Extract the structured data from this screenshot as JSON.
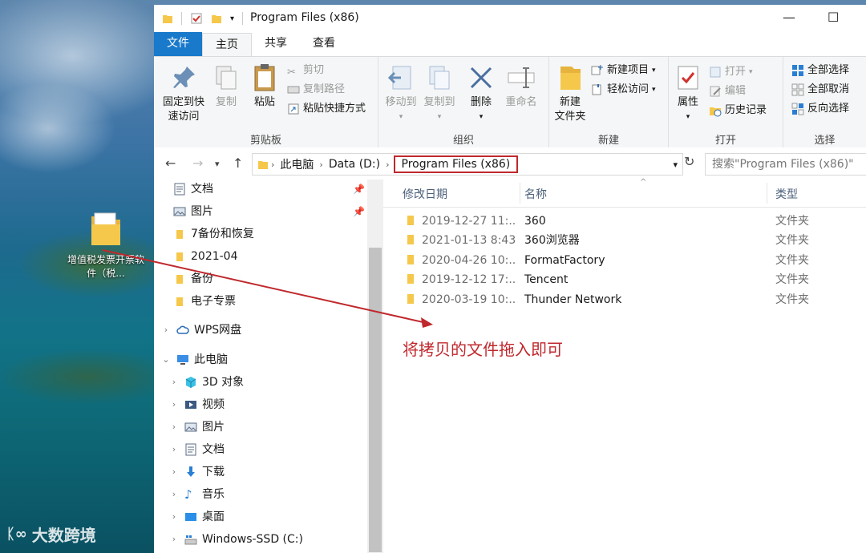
{
  "desktop": {
    "icon_label": "增值税发票开票软件（税...",
    "watermark": "大数跨境"
  },
  "window": {
    "title": "Program Files (x86)"
  },
  "ribbon_tabs": [
    "文件",
    "主页",
    "共享",
    "查看"
  ],
  "ribbon": {
    "clipboard": {
      "pin": "固定到快\n速访问",
      "copy": "复制",
      "paste": "粘贴",
      "cut": "剪切",
      "copy_path": "复制路径",
      "paste_shortcut": "粘贴快捷方式",
      "group": "剪贴板"
    },
    "organize": {
      "move_to": "移动到",
      "copy_to": "复制到",
      "delete": "删除",
      "rename": "重命名",
      "group": "组织"
    },
    "new": {
      "new_folder": "新建\n文件夹",
      "new_item": "新建项目",
      "easy_access": "轻松访问",
      "group": "新建"
    },
    "open": {
      "properties": "属性",
      "open": "打开",
      "edit": "编辑",
      "history": "历史记录",
      "group": "打开"
    },
    "select": {
      "select_all": "全部选择",
      "select_none": "全部取消",
      "invert": "反向选择",
      "group": "选择"
    }
  },
  "address": {
    "crumbs": [
      "此电脑",
      "Data (D:)",
      "Program Files (x86)"
    ],
    "search_placeholder": "搜索\"Program Files (x86)\""
  },
  "nav": {
    "quick": [
      {
        "label": "文档",
        "pinned": true
      },
      {
        "label": "图片",
        "pinned": true
      },
      {
        "label": "7备份和恢复"
      },
      {
        "label": "2021-04"
      },
      {
        "label": "备份"
      },
      {
        "label": "电子专票"
      }
    ],
    "wps": "WPS网盘",
    "this_pc": "此电脑",
    "pc_items": [
      "3D 对象",
      "视频",
      "图片",
      "文档",
      "下载",
      "音乐",
      "桌面",
      "Windows-SSD (C:)"
    ]
  },
  "columns": {
    "date": "修改日期",
    "name": "名称",
    "type": "类型"
  },
  "files": [
    {
      "date": "2019-12-27 11:...",
      "name": "360",
      "type": "文件夹"
    },
    {
      "date": "2021-01-13 8:43",
      "name": "360浏览器",
      "type": "文件夹"
    },
    {
      "date": "2020-04-26 10:...",
      "name": "FormatFactory",
      "type": "文件夹"
    },
    {
      "date": "2019-12-12 17:...",
      "name": "Tencent",
      "type": "文件夹"
    },
    {
      "date": "2020-03-19 10:...",
      "name": "Thunder Network",
      "type": "文件夹"
    }
  ],
  "annotation": "将拷贝的文件拖入即可",
  "colors": {
    "accent": "#1979ca",
    "annotation_red": "#c0282d",
    "folder_yellow": "#f5c84c"
  }
}
